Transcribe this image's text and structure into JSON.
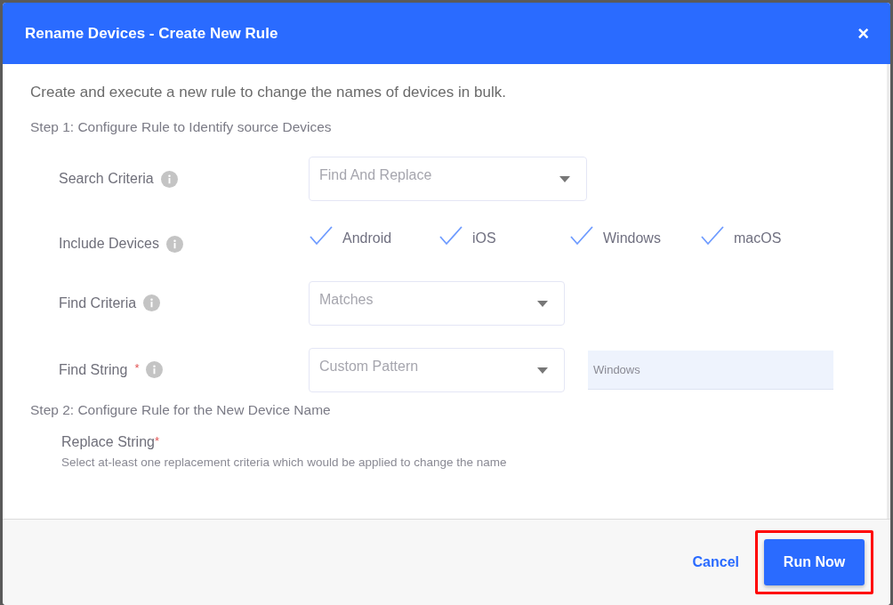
{
  "dialog": {
    "title": "Rename Devices - Create New Rule",
    "close": "×"
  },
  "intro": "Create and execute a new rule to change the names of devices in bulk.",
  "step1": {
    "title": "Step 1: Configure Rule to Identify source Devices",
    "rows": [
      {
        "kind": "select",
        "label": "Search Criteria",
        "value": "Find And Replace"
      },
      {
        "kind": "checkboxes",
        "label": "Include Devices",
        "options": [
          {
            "label": "Android",
            "checked": true
          },
          {
            "label": "iOS",
            "checked": true
          },
          {
            "label": "Windows",
            "checked": true
          },
          {
            "label": "macOS",
            "checked": true
          }
        ]
      },
      {
        "kind": "select",
        "label": "Find Criteria",
        "value": "Matches"
      },
      {
        "kind": "select_input",
        "label": "Find String",
        "required_mark": "*",
        "value": "Custom Pattern",
        "input_value": "Windows"
      }
    ]
  },
  "step2": {
    "title": "Step 2: Configure Rule for the New Device Name",
    "label": "Replace String",
    "required_mark": "*",
    "hint": "Select at-least one replacement criteria which would be applied to change the name"
  },
  "footer": {
    "cancel": "Cancel",
    "run": "Run Now",
    "run_highlighted": true
  }
}
